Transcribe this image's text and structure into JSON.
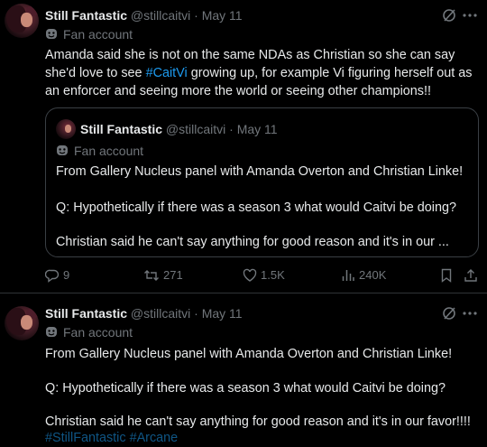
{
  "tweets": [
    {
      "author_name": "Still Fantastic",
      "author_handle": "@stillcaitvi",
      "separator": "·",
      "date": "May 11",
      "account_label": "Fan account",
      "text_before_hashtag": "Amanda said she is not on the same NDAs as Christian so she can say she'd love to see ",
      "hashtag": "#CaitVi",
      "text_after_hashtag": " growing up, for example Vi figuring herself out as an enforcer and seeing more the world or seeing other champions!!",
      "quote": {
        "author_name": "Still Fantastic",
        "author_handle": "@stillcaitvi",
        "separator": "·",
        "date": "May 11",
        "account_label": "Fan account",
        "lines": [
          "From Gallery Nucleus panel with Amanda Overton and Christian Linke!",
          "Q: Hypothetically if there was a season 3 what would Caitvi be doing?",
          "Christian said he can't say anything for good reason and it's in our ..."
        ]
      },
      "actions": {
        "replies": "9",
        "reposts": "271",
        "likes": "1.5K",
        "views": "240K"
      }
    },
    {
      "author_name": "Still Fantastic",
      "author_handle": "@stillcaitvi",
      "separator": "·",
      "date": "May 11",
      "account_label": "Fan account",
      "lines": [
        "From Gallery Nucleus panel with Amanda Overton and Christian Linke!",
        "Q: Hypothetically if there was a season 3 what would Caitvi be doing?",
        "Christian said he can't say anything for good reason and it's in our favor!!!!"
      ],
      "cut_off_line": "#StillFantastic #Arcane"
    }
  ],
  "icons": {
    "grok": "grok-icon",
    "more": "more-icon",
    "mask": "theater-mask-icon",
    "reply": "reply-icon",
    "repost": "repost-icon",
    "like": "heart-icon",
    "views": "views-icon",
    "bookmark": "bookmark-icon",
    "share": "share-icon"
  },
  "colors": {
    "background": "#000000",
    "text": "#e7e9ea",
    "muted": "#71767b",
    "link": "#1d9bf0",
    "border": "#2f3336"
  }
}
